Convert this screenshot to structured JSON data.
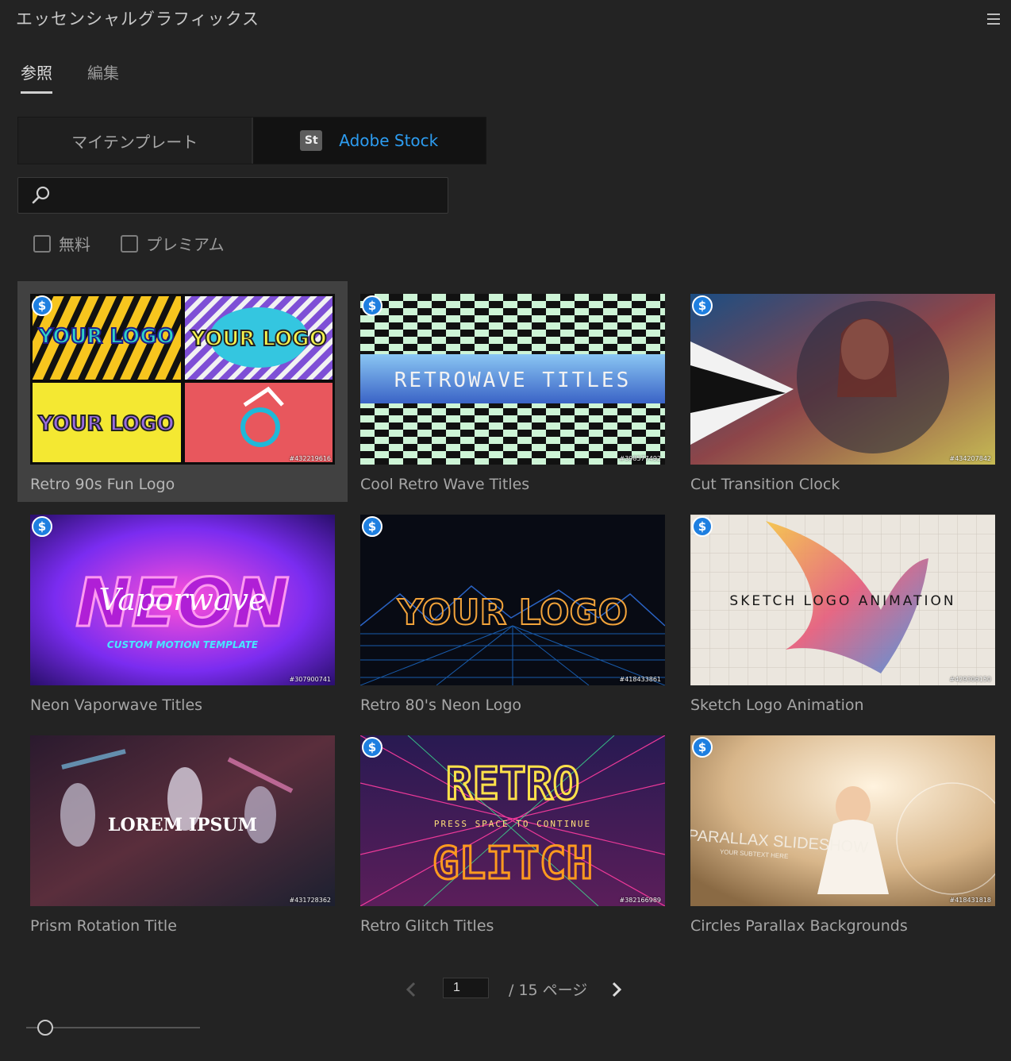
{
  "panel": {
    "title": "エッセンシャルグラフィックス",
    "menu_icon": "hamburger-menu-icon"
  },
  "tabs": [
    {
      "label": "参照",
      "active": true
    },
    {
      "label": "編集",
      "active": false
    }
  ],
  "source": {
    "my_templates": "マイテンプレート",
    "adobe_stock": "Adobe Stock",
    "stock_badge": "St",
    "active": "adobe_stock"
  },
  "search": {
    "value": "",
    "placeholder": "",
    "icon": "search-icon"
  },
  "filters": [
    {
      "label": "無料",
      "checked": false
    },
    {
      "label": "プレミアム",
      "checked": false
    }
  ],
  "templates": [
    {
      "title": "Retro 90s Fun Logo",
      "id": "#432219616",
      "premium": true,
      "selected": true,
      "overlay_text": ""
    },
    {
      "title": "Cool Retro Wave Titles",
      "id": "#398577492",
      "premium": true,
      "selected": false,
      "overlay_text": "RETROWAVE TITLES"
    },
    {
      "title": "Cut Transition Clock",
      "id": "#434207842",
      "premium": true,
      "selected": false,
      "overlay_text": ""
    },
    {
      "title": "Neon Vaporwave Titles",
      "id": "#307900741",
      "premium": true,
      "selected": false,
      "overlay_text": "NEON"
    },
    {
      "title": "Retro 80's Neon Logo",
      "id": "#418433861",
      "premium": true,
      "selected": false,
      "overlay_text": "YOUR LOGO"
    },
    {
      "title": "Sketch Logo Animation",
      "id": "#429306150",
      "premium": true,
      "selected": false,
      "overlay_text": "SKETCH LOGO ANIMATION"
    },
    {
      "title": "Prism Rotation Title",
      "id": "#431728362",
      "premium": false,
      "selected": false,
      "overlay_text": "LOREM IPSUM"
    },
    {
      "title": "Retro Glitch Titles",
      "id": "#382166989",
      "premium": true,
      "selected": false,
      "overlay_text": "RETRO"
    },
    {
      "title": "Circles Parallax Backgrounds",
      "id": "#418431818",
      "premium": true,
      "selected": false,
      "overlay_text": "PARALLAX SLIDESHOW"
    }
  ],
  "thumbnail_text": {
    "retro90s": {
      "tile1": "YOUR LOGO",
      "tile2": "YOUR LOGO",
      "tile3": "YOUR LOGO"
    },
    "neon": {
      "script": "Vaporwave",
      "sub": "CUSTOM MOTION TEMPLATE"
    },
    "glitch": {
      "line2": "PRESS SPACE TO CONTINUE",
      "line3": "GLITCH"
    },
    "parallax": {
      "sub": "YOUR SUBTEXT HERE"
    }
  },
  "premium_badge": "$",
  "pagination": {
    "current": "1",
    "total_label": "/ 15 ページ"
  },
  "zoom": {
    "level": 0.07
  },
  "colors": {
    "accent": "#2d9cf0",
    "background": "#232323",
    "premium_badge": "#1e7fe0"
  }
}
